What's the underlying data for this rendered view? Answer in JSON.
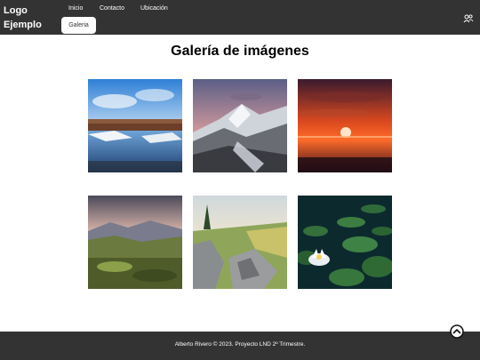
{
  "header": {
    "logo": "Logo Ejemplo",
    "nav": [
      {
        "label": "Inicio"
      },
      {
        "label": "Contacto"
      },
      {
        "label": "Ubicación"
      },
      {
        "label": "Galeria"
      }
    ],
    "active_index": 3
  },
  "main": {
    "title": "Galería de imágenes",
    "images": [
      {
        "subject": "river-landscape"
      },
      {
        "subject": "snowy-mountain"
      },
      {
        "subject": "sunset-sky"
      },
      {
        "subject": "mountain-valley"
      },
      {
        "subject": "rocky-cliff"
      },
      {
        "subject": "water-lily"
      }
    ]
  },
  "footer": {
    "text": "Alberto Rivero © 2023. Proyecto LND 2º Trimestre."
  },
  "colors": {
    "bar": "#333333",
    "background": "#ffffff",
    "active_tab": "#ffffff"
  },
  "icons": [
    "users-icon",
    "arrow-up-circle-icon"
  ]
}
